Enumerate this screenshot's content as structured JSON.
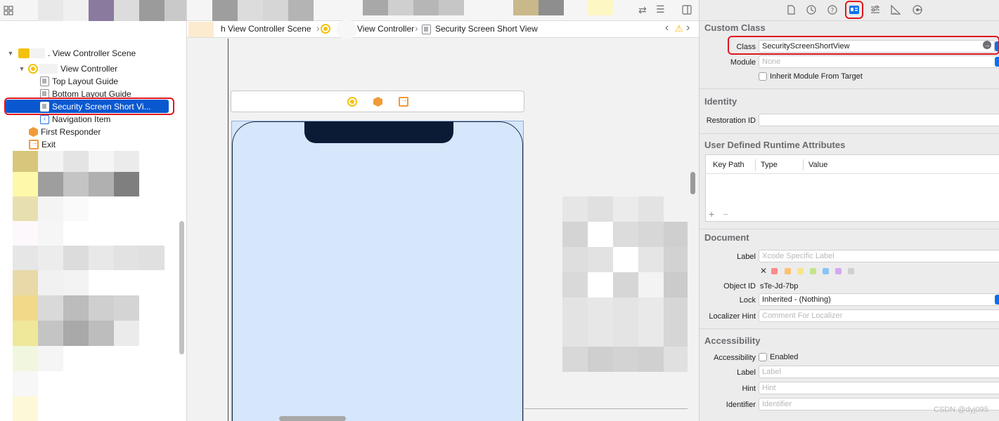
{
  "navigator": {
    "tree": [
      {
        "label": ". View Controller Scene",
        "icon": "storyboard-scene-icon"
      },
      {
        "label": "View Controller",
        "icon": "view-controller-icon"
      },
      {
        "label": "Top Layout Guide",
        "icon": "layout-guide-icon"
      },
      {
        "label": "Bottom Layout Guide",
        "icon": "layout-guide-icon"
      },
      {
        "label": "Security Screen Short Vi...",
        "icon": "view-icon"
      },
      {
        "label": "Navigation Item",
        "icon": "navigation-item-icon"
      },
      {
        "label": "First Responder",
        "icon": "first-responder-icon"
      },
      {
        "label": "Exit",
        "icon": "exit-icon"
      }
    ]
  },
  "canvas": {
    "breadcrumb": [
      {
        "label": "h View Controller Scene"
      },
      {
        "label": "View Controller"
      },
      {
        "label": "Security Screen Short View"
      }
    ]
  },
  "inspector": {
    "custom_class": {
      "title": "Custom Class",
      "class_label": "Class",
      "class_value": "SecurityScreenShortView",
      "module_label": "Module",
      "module_placeholder": "None",
      "inherit_label": "Inherit Module From Target"
    },
    "identity": {
      "title": "Identity",
      "restoration_label": "Restoration ID"
    },
    "runtime": {
      "title": "User Defined Runtime Attributes",
      "col_key": "Key Path",
      "col_type": "Type",
      "col_value": "Value",
      "add": "+",
      "remove": "−"
    },
    "document": {
      "title": "Document",
      "label_label": "Label",
      "label_placeholder": "Xcode Specific Label",
      "object_id_label": "Object ID",
      "object_id_value": "sTe-Jd-7bp",
      "lock_label": "Lock",
      "lock_value": "Inherited - (Nothing)",
      "localizer_label": "Localizer Hint",
      "localizer_placeholder": "Comment For Localizer",
      "swatches": [
        "#ff6b6b",
        "#ffb347",
        "#f7e06a",
        "#b5e06a",
        "#6ab5f7",
        "#c28cf0",
        "#c8c8c8"
      ]
    },
    "accessibility": {
      "title": "Accessibility",
      "accessibility_label": "Accessibility",
      "enabled_label": "Enabled",
      "label_label": "Label",
      "label_placeholder": "Label",
      "hint_label": "Hint",
      "hint_placeholder": "Hint",
      "identifier_label": "Identifier",
      "identifier_placeholder": "Identifier"
    }
  },
  "watermark": "CSDN @dyj095",
  "colors": {
    "selection": "#0a58d0",
    "highlight_red": "#e0161e",
    "accent_blue": "#0a6ff0",
    "canvas_view": "#d6e6fb"
  }
}
